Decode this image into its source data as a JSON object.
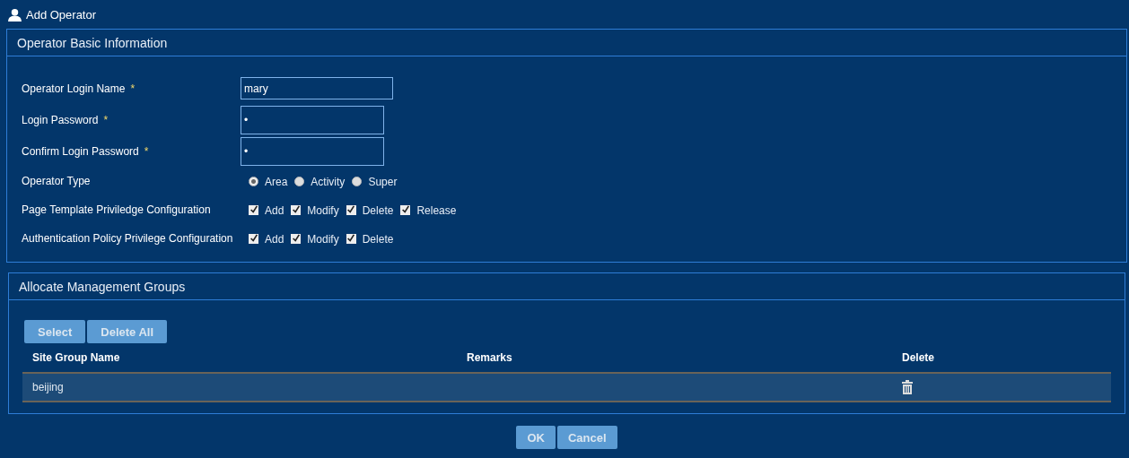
{
  "window": {
    "title": "Add Operator"
  },
  "basic_info": {
    "title": "Operator Basic Information",
    "fields": [
      {
        "kind": "text",
        "label": "Operator Login Name",
        "required_mark": "*",
        "value": "mary"
      },
      {
        "kind": "password",
        "label": "Login Password",
        "required_mark": "*",
        "value": "•"
      },
      {
        "kind": "password",
        "label": "Confirm Login Password",
        "required_mark": "*",
        "value": "•"
      },
      {
        "kind": "radio",
        "label": "Operator Type",
        "options": [
          {
            "label": "Area",
            "selected": true
          },
          {
            "label": "Activity",
            "selected": false
          },
          {
            "label": "Super",
            "selected": false
          }
        ]
      },
      {
        "kind": "checkbox",
        "label": "Page Template Priviledge Configuration",
        "options": [
          {
            "label": "Add",
            "checked": true
          },
          {
            "label": "Modify",
            "checked": true
          },
          {
            "label": "Delete",
            "checked": true
          },
          {
            "label": "Release",
            "checked": true
          }
        ]
      },
      {
        "kind": "checkbox",
        "label": "Authentication Policy Privilege Configuration",
        "options": [
          {
            "label": "Add",
            "checked": true
          },
          {
            "label": "Modify",
            "checked": true
          },
          {
            "label": "Delete",
            "checked": true
          }
        ]
      }
    ]
  },
  "groups": {
    "title": "Allocate Management Groups",
    "buttons": [
      "Select",
      "Delete All"
    ],
    "table": {
      "columns": [
        "Site Group Name",
        "Remarks",
        "Delete"
      ],
      "rows": [
        {
          "site_group_name": "beijing"
        }
      ]
    }
  },
  "buttons": [
    "OK",
    "Cancel"
  ]
}
